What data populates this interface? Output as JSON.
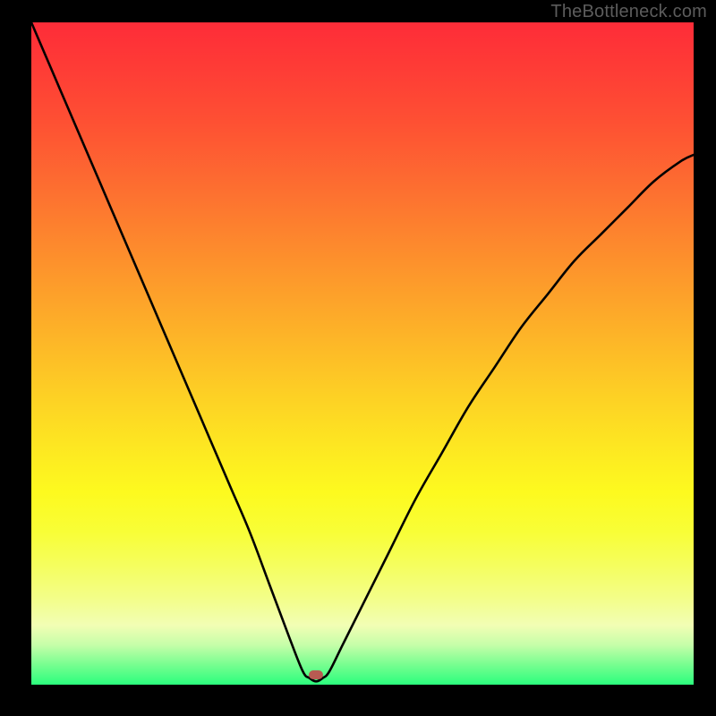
{
  "watermark": "TheBottleneck.com",
  "chart_data": {
    "type": "line",
    "title": "",
    "xlabel": "",
    "ylabel": "",
    "xlim": [
      0,
      100
    ],
    "ylim": [
      0,
      100
    ],
    "x": [
      0,
      3,
      6,
      9,
      12,
      15,
      18,
      21,
      24,
      27,
      30,
      33,
      36,
      39,
      41,
      42,
      43,
      44,
      45,
      47,
      50,
      54,
      58,
      62,
      66,
      70,
      74,
      78,
      82,
      86,
      90,
      94,
      98,
      100
    ],
    "y": [
      100,
      93,
      86,
      79,
      72,
      65,
      58,
      51,
      44,
      37,
      30,
      23,
      15,
      7,
      2,
      1,
      0.5,
      1,
      2,
      6,
      12,
      20,
      28,
      35,
      42,
      48,
      54,
      59,
      64,
      68,
      72,
      76,
      79,
      80
    ],
    "marker": {
      "x": 43,
      "y": 1.5
    },
    "background_gradient": {
      "top": "#fe2c38",
      "mid": "#fde021",
      "bottom": "#2bfe7d"
    }
  }
}
